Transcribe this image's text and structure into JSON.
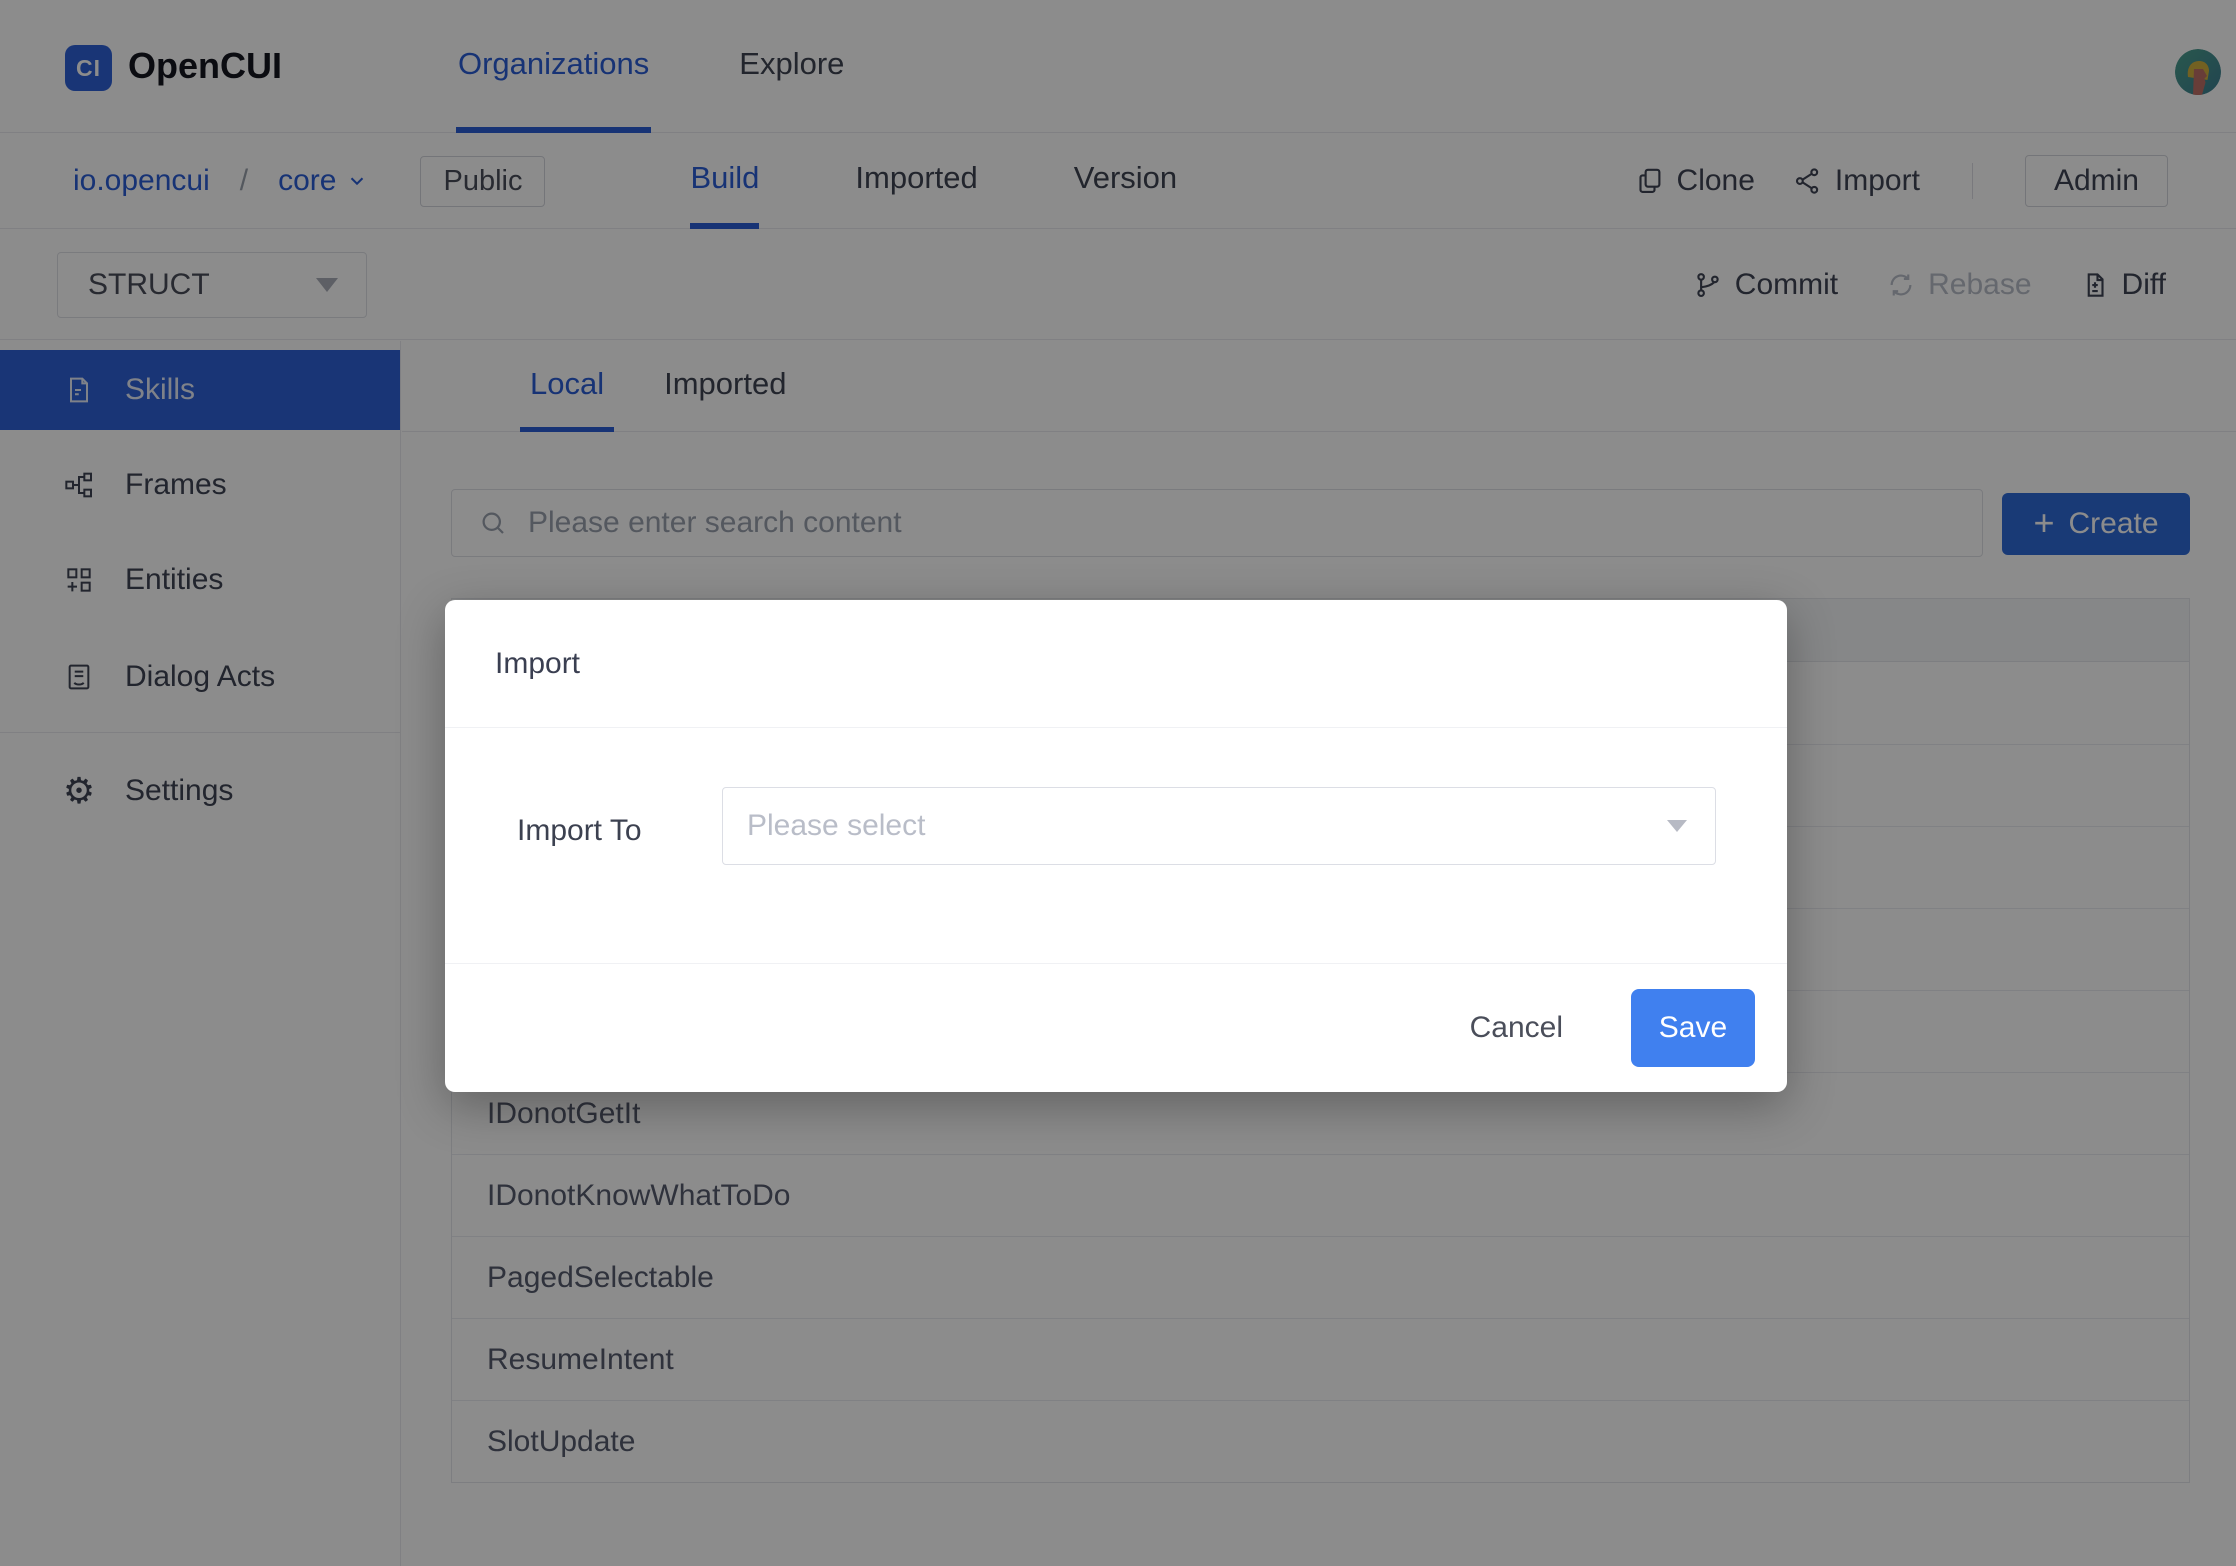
{
  "colors": {
    "primary_blue": "#2f62d8",
    "link_blue": "#2b5dd6",
    "save_blue": "#4080ef",
    "selected_menu_bg": "#2f62d8",
    "overlay": "rgba(0,0,0,0.45)"
  },
  "header": {
    "brand": "OpenCUI",
    "logo_monogram": "CI",
    "nav": [
      {
        "label": "Organizations",
        "active": true
      },
      {
        "label": "Explore",
        "active": false
      }
    ]
  },
  "project_bar": {
    "org": "io.opencui",
    "separator": "/",
    "project": "core",
    "visibility": "Public",
    "tabs": [
      {
        "label": "Build",
        "active": true
      },
      {
        "label": "Imported",
        "active": false
      },
      {
        "label": "Version",
        "active": false
      }
    ],
    "clone": "Clone",
    "import": "Import",
    "admin": "Admin"
  },
  "toolbar": {
    "mode": "STRUCT",
    "commit": "Commit",
    "rebase": "Rebase",
    "rebase_disabled": true,
    "diff": "Diff"
  },
  "sidebar": {
    "items": [
      {
        "label": "Skills",
        "active": true
      },
      {
        "label": "Frames",
        "active": false
      },
      {
        "label": "Entities",
        "active": false
      },
      {
        "label": "Dialog Acts",
        "active": false
      }
    ],
    "settings": "Settings"
  },
  "content": {
    "tabs": [
      {
        "label": "Local",
        "active": true
      },
      {
        "label": "Imported",
        "active": false
      }
    ],
    "search_placeholder": "Please enter search content",
    "create": "Create",
    "table": {
      "visible_rows": [
        "IDonotGetIt",
        "IDonotKnowWhatToDo",
        "PagedSelectable",
        "ResumeIntent",
        "SlotUpdate"
      ],
      "obscured_row_count": 5
    }
  },
  "modal": {
    "title": "Import",
    "field_label": "Import To",
    "select_placeholder": "Please select",
    "cancel": "Cancel",
    "save": "Save"
  }
}
